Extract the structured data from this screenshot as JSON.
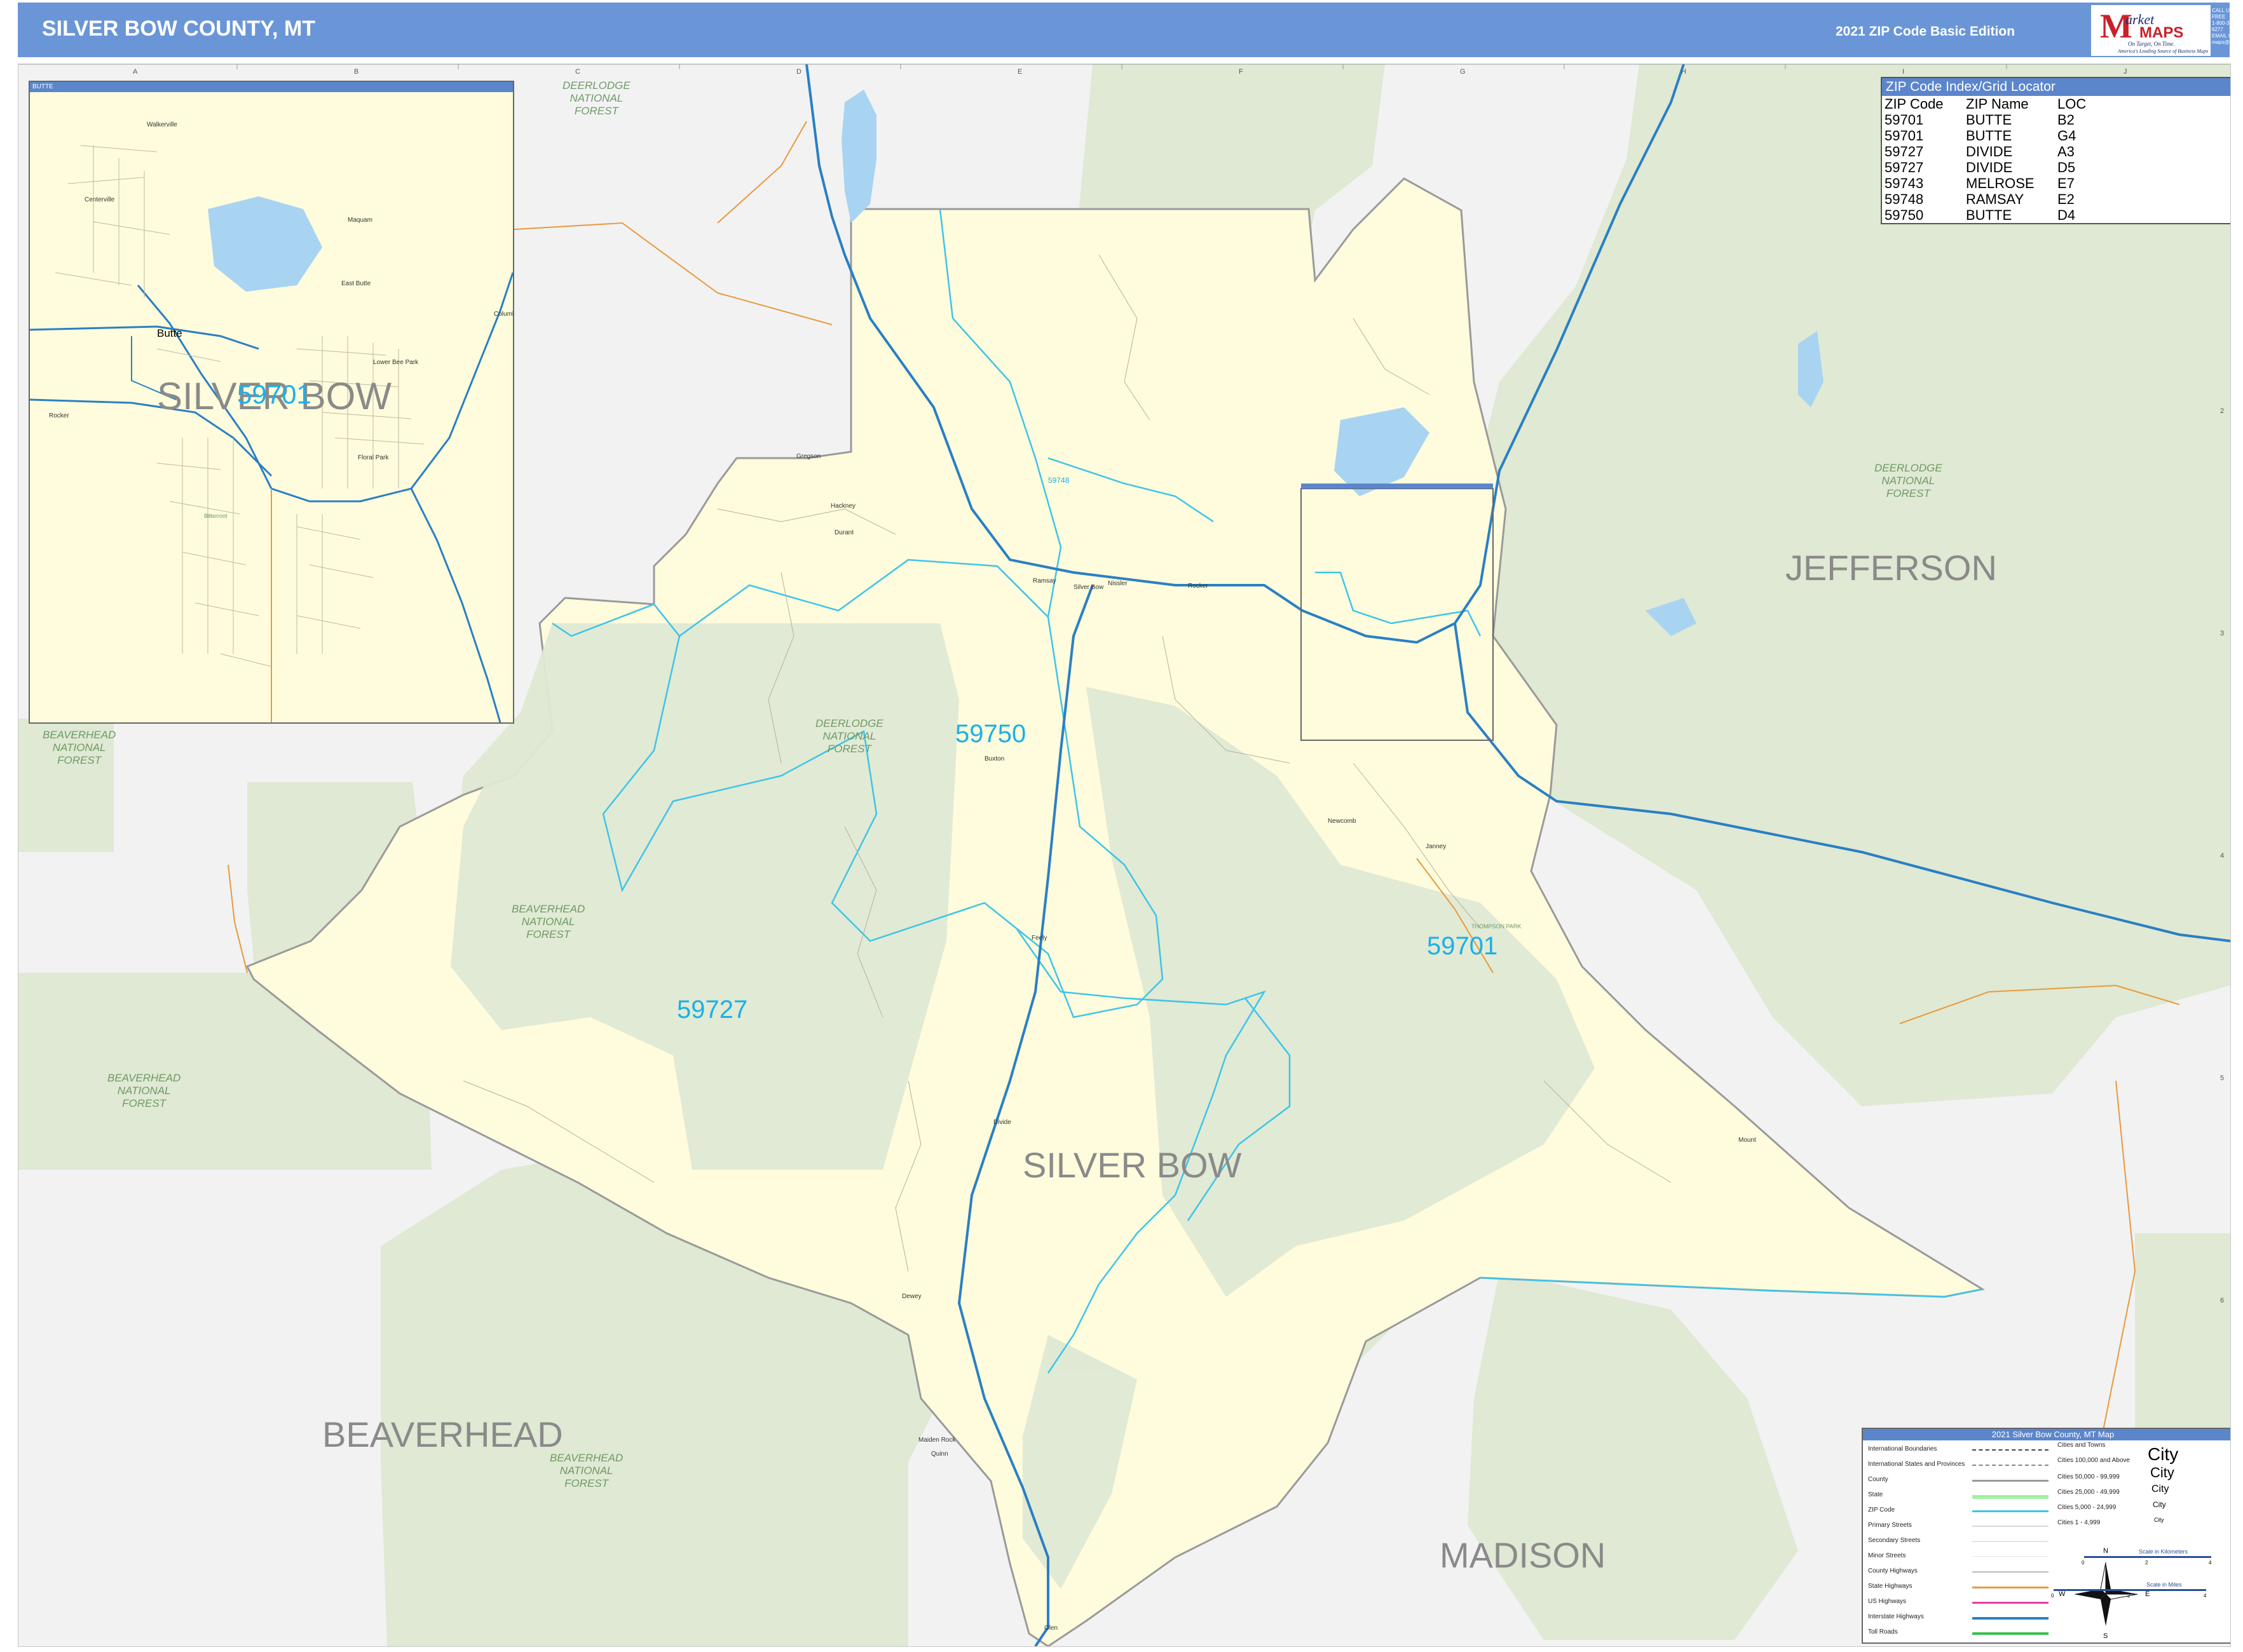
{
  "header": {
    "title": "SILVER BOW COUNTY, MT",
    "edition": "2021 ZIP Code Basic Edition",
    "logo_market": "arket",
    "logo_maps": "MAPS",
    "logo_tag": "On Target, On Time.",
    "logo_tag2": "America's Leading Source of Business Maps",
    "contact": [
      "CALL US TOLL FREE",
      "1-800-334-6277",
      "EMAIL US AT",
      "maps@marketmaps.com"
    ]
  },
  "colors": {
    "header": "#6a96d8",
    "county_fill": "#fefcdc",
    "forest": "#dfe9d3",
    "background": "#f2f2f3",
    "zip_boundary": "#3ec4ea",
    "interstate": "#2a7fc4",
    "state_highway": "#e89a3c",
    "county_boundary": "#9a9a9a"
  },
  "grid": {
    "columns": [
      "A",
      "B",
      "C",
      "D",
      "E",
      "F",
      "G",
      "H",
      "I",
      "J"
    ],
    "rows": [
      "1",
      "2",
      "3",
      "4",
      "5",
      "6",
      "7"
    ]
  },
  "counties": {
    "silver_bow": "SILVER BOW",
    "jefferson": "JEFFERSON",
    "beaverhead": "BEAVERHEAD",
    "madison": "MADISON"
  },
  "zip_labels": {
    "z59750": "59750",
    "z59727": "59727",
    "z59701": "59701",
    "z59748": "59748"
  },
  "forests": {
    "deerlodge_top": [
      "DEERLODGE",
      "NATIONAL",
      "FOREST"
    ],
    "deerlodge_center": [
      "DEERLODGE",
      "NATIONAL",
      "FOREST"
    ],
    "deerlodge_east": [
      "DEERLODGE",
      "NATIONAL",
      "FOREST"
    ],
    "beaverhead_w": [
      "BEAVERHEAD",
      "NATIONAL",
      "FOREST"
    ],
    "beaverhead_c": [
      "BEAVERHEAD",
      "NATIONAL",
      "FOREST"
    ],
    "beaverhead_sw": [
      "BEAVERHEAD",
      "NATIONAL",
      "FOREST"
    ],
    "beaverhead_s": [
      "BEAVERHEAD",
      "NATIONAL",
      "FOREST"
    ]
  },
  "places": {
    "gregson": "Gregson",
    "hackney": "Hackney",
    "durant": "Durant",
    "ramsay": "Ramsay",
    "silver_bow": "Silver Bow",
    "nissler": "Nissler",
    "rocker": "Rocker",
    "buxton": "Buxton",
    "feely": "Feely",
    "newcomb": "Newcomb",
    "janney": "Janney",
    "thompson_park": "THOMPSON PARK",
    "divide": "Divide",
    "dewey": "Dewey",
    "maiden_rock": "Maiden Rock",
    "quinn": "Quinn",
    "glen": "Glen",
    "mount": "Mount"
  },
  "inset": {
    "title": "BUTTE",
    "county_label": "SILVER BOW",
    "zip_label": "59701",
    "places": {
      "walkerville": "Walkerville",
      "centerville": "Centerville",
      "maquam": "Maquam",
      "east_butte": "East Butte",
      "butte": "Butte",
      "columbia_gardens": "Columbia Gardens",
      "lower_bee_park": "Lower Bee Park",
      "rocker": "Rocker",
      "floral_park": "Floral Park",
      "bitterroot": "Bitterroot"
    }
  },
  "zip_index": {
    "title": "ZIP Code Index/Grid Locator",
    "columns": [
      "ZIP Code",
      "ZIP Name",
      "LOC"
    ],
    "rows": [
      [
        "59701",
        "BUTTE",
        "B2"
      ],
      [
        "59701",
        "BUTTE",
        "G4"
      ],
      [
        "59727",
        "DIVIDE",
        "A3"
      ],
      [
        "59727",
        "DIVIDE",
        "D5"
      ],
      [
        "59743",
        "MELROSE",
        "E7"
      ],
      [
        "59748",
        "RAMSAY",
        "E2"
      ],
      [
        "59750",
        "BUTTE",
        "D4"
      ]
    ]
  },
  "legend": {
    "title": "2021 Silver Bow County, MT Map",
    "features": [
      "International Boundaries",
      "International States and Provinces",
      "County",
      "State",
      "ZIP Code",
      "Primary Streets",
      "Secondary Streets",
      "Minor Streets",
      "County Highways",
      "State Highways",
      "US Highways",
      "Interstate Highways",
      "Toll Roads"
    ],
    "city_classes": [
      "Cities and Towns",
      "Cities 100,000 and Above",
      "Cities 50,000 - 99,999",
      "Cities 25,000 - 49,999",
      "Cities 5,000 - 24,999",
      "Cities 1 - 4,999"
    ],
    "city_word": "City",
    "scale_km": "Scale in Kilometers",
    "scale_mi": "Scale in Miles",
    "scale_ticks": [
      "0",
      "2",
      "4"
    ],
    "compass": [
      "N",
      "S",
      "E",
      "W"
    ]
  }
}
